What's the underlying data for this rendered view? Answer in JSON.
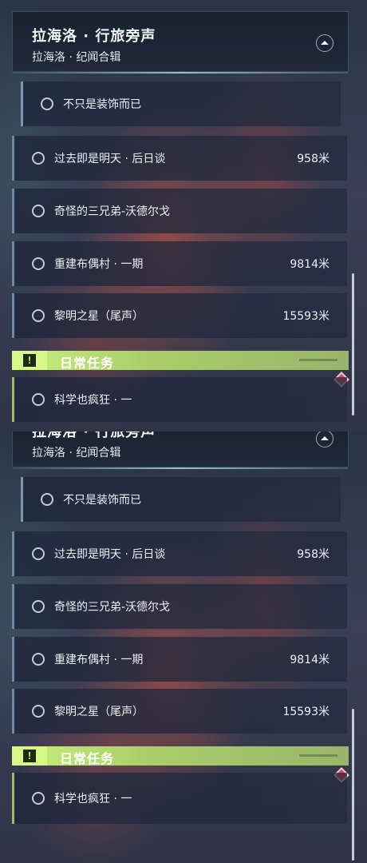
{
  "header": {
    "title": "拉海洛 · 行旅旁声",
    "subtitle": "拉海洛 · 纪闻合辑"
  },
  "quests": [
    {
      "label": "不只是装饰而已",
      "distance": ""
    },
    {
      "label": "过去即是明天 · 后日谈",
      "distance": "958米"
    },
    {
      "label": "奇怪的三兄弟-沃德尔戈",
      "distance": ""
    },
    {
      "label": "重建布偶村 · 一期",
      "distance": "9814米"
    },
    {
      "label": "黎明之星（尾声）",
      "distance": "15593米"
    }
  ],
  "daily": {
    "section_title": "日常任务",
    "icon": "!",
    "items": [
      {
        "label": "科学也疯狂 · 一"
      }
    ]
  },
  "colors": {
    "accent_green": "#c7f07e",
    "tracker_diamond": "#e0475a"
  }
}
